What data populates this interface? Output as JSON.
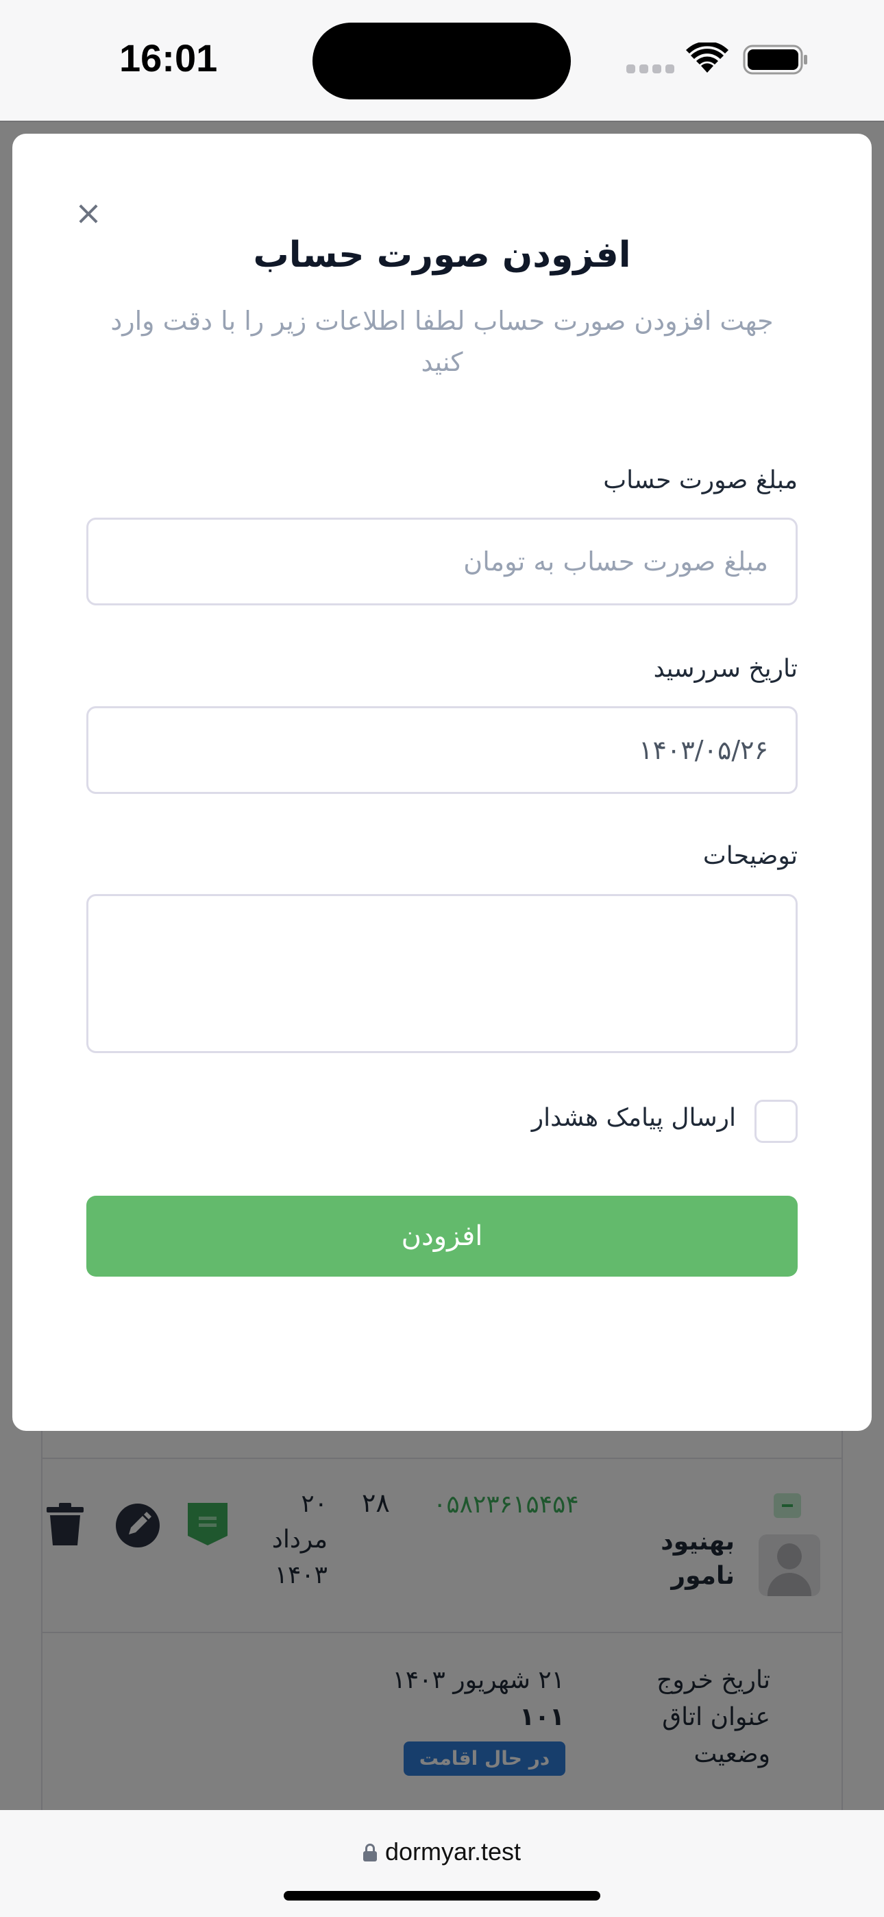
{
  "status_bar": {
    "time": "16:01"
  },
  "background_list": {
    "guest_name": "بهنیود نامور",
    "phone": "۰۵۸۲۳۶۱۵۴۵۴",
    "room_count": "۲۸",
    "date_day": "۲۰",
    "date_month": "مرداد",
    "date_year": "۱۴۰۳",
    "details": [
      {
        "label": "تاریخ خروج",
        "value": "۲۱ شهریور ۱۴۰۳"
      },
      {
        "label": "عنوان اتاق",
        "value": "۱۰۱"
      },
      {
        "label": "وضعیت",
        "value": "در حال اقامت"
      }
    ],
    "colors": {
      "status_pill": "#2f7dd8",
      "accent_green": "#3fae5c"
    }
  },
  "modal": {
    "close_symbol": "×",
    "title": "افزودن صورت حساب",
    "subtitle": "جهت افزودن صورت حساب لطفا اطلاعات زیر را با دقت وارد کنید",
    "amount_field": {
      "label": "مبلغ صورت حساب",
      "placeholder": "مبلغ صورت حساب به تومان",
      "value": ""
    },
    "due_date_field": {
      "label": "تاریخ سررسید",
      "value": "۱۴۰۳/۰۵/۲۶"
    },
    "description_field": {
      "label": "توضیحات",
      "value": ""
    },
    "sms_checkbox": {
      "label": "ارسال پیامک هشدار",
      "checked": false
    },
    "submit_label": "افزودن",
    "colors": {
      "submit": "#63ba6c"
    }
  },
  "browser": {
    "url": "dormyar.test"
  }
}
